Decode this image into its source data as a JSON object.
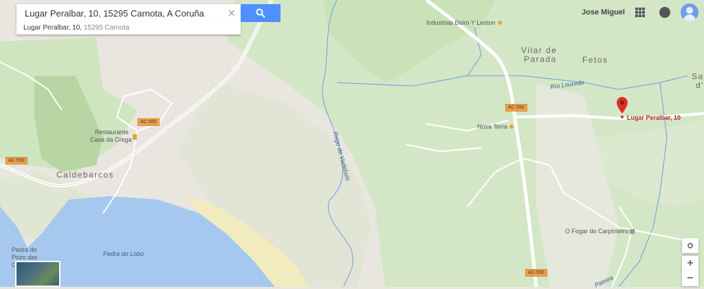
{
  "search": {
    "value": "Lugar Peralbar, 10, 15295 Carnota, A Coruña",
    "suggestion_main": "Lugar Peralbar, 10,",
    "suggestion_sub": "15295 Carnota"
  },
  "header": {
    "user_name": "Jose Miguel"
  },
  "map_labels": {
    "caldebarcos": "Caldebarcos",
    "vilar_line1": "Vilar de",
    "vilar_line2": "Parada",
    "fetos": "Fetos",
    "sa": "Sa",
    "sa2": "d'",
    "restaurante_line1": "Restaurante",
    "restaurante_line2": "Casa da Crega",
    "industrias": "Industrias Beiro Y Leston",
    "nosa_terra": "Nosa Terra",
    "fogar": "O Fogar do Carpinteiro",
    "pedra_pozo_line1": "Pedra do",
    "pedra_pozo_line2": "Pozo das",
    "pedra_pozo_line3": "C",
    "pedra_lobo": "Pedra do Lobo",
    "rio_louredo": "Río Louredo",
    "rego_vadebois": "Rego de Vadebois",
    "pateira": "Pateira",
    "road_ac550": "AC-550",
    "pin_label": "Lugar Peralbar, 10"
  },
  "colors": {
    "land": "#e9e6df",
    "green": "#cfe5c0",
    "green_dark": "#b7d6a3",
    "water": "#a6c8ef",
    "sand": "#f2ebbe",
    "road": "#ffffff",
    "river": "#6a9ce0",
    "pin": "#d93025",
    "search_button": "#4d90fe"
  },
  "icons": {
    "search": "search-icon",
    "clear": "close-icon",
    "apps": "apps-grid-icon",
    "notifications": "bell-icon",
    "avatar": "avatar-icon",
    "location": "my-location-icon",
    "zoom_in": "plus-icon",
    "zoom_out": "minus-icon",
    "pin": "map-pin-icon"
  },
  "controls": {
    "zoom_in": "+",
    "zoom_out": "−"
  }
}
